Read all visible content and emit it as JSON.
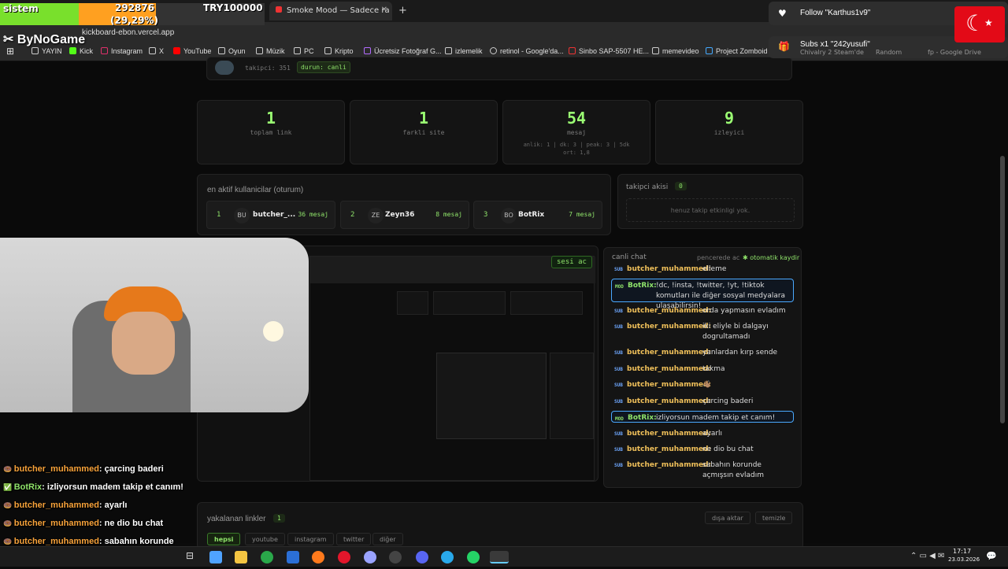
{
  "browser": {
    "tab_title": "Smoke Mood — Sadece ra",
    "address": "kickboard-ebon.vercel.app",
    "bookmarks": [
      "YAYIN",
      "Kick",
      "Instagram",
      "X",
      "YouTube",
      "Oyun",
      "Müzik",
      "PC",
      "Kripto",
      "Ücretsiz Fotoğraf G...",
      "izlemelik",
      "retinol - Google'da...",
      "Sinbo SAP-5507 HE...",
      "memevideo",
      "Project Zomboid S..."
    ],
    "popup_follow": "Follow \"Karthus1v9\"",
    "popup_subs": "Subs x1 \"242yusufi\"",
    "popup_sub_links": [
      "Chivalry 2 Steam'de",
      "Random",
      "fp - Google Drive"
    ]
  },
  "stream_overlay": {
    "label_left": "sistem",
    "counter_value": "292876",
    "counter_pct": "(29,29%)",
    "counter_target": "TRY100000",
    "brand": "ByNoGame",
    "progress_fraction": 0.2929
  },
  "header_card": {
    "followers_label": "takipci: 351",
    "status_label": "durun: canli"
  },
  "stats": [
    {
      "value": "1",
      "label": "toplam link",
      "sub": ""
    },
    {
      "value": "1",
      "label": "farkli site",
      "sub": ""
    },
    {
      "value": "54",
      "label": "mesaj",
      "sub": "anlik: 1 | dk: 3 | peak: 3 | 5dk ort: 1,8"
    },
    {
      "value": "9",
      "label": "izleyici",
      "sub": ""
    }
  ],
  "active_users": {
    "title": "en aktif kullanicilar (oturum)",
    "users": [
      {
        "rank": "1",
        "initials": "BU",
        "name": "butcher_...",
        "count": "36 mesaj"
      },
      {
        "rank": "2",
        "initials": "ZE",
        "name": "Zeyn36",
        "count": "8 mesaj"
      },
      {
        "rank": "3",
        "initials": "BO",
        "name": "BotRix",
        "count": "7 mesaj"
      }
    ]
  },
  "follow_flow": {
    "title": "takipci akisi",
    "count": "0",
    "empty": "henuz takip etkinligi yok."
  },
  "preview": {
    "audio_button": "sesi ac"
  },
  "live_chat": {
    "title": "canli chat",
    "popout": "pencerede ac",
    "autoscroll": "otomatik kaydir",
    "messages": [
      {
        "badge": "SUB",
        "user": "butcher_muhammed:",
        "text": "elleme",
        "bot": false
      },
      {
        "badge": "MOD",
        "user": "BotRix:",
        "text": "!dc, !insta, !twitter, !yt, !tiktok komutları ile diğer sosyal medyalara ulaşabilirsin!",
        "bot": true
      },
      {
        "badge": "SUB",
        "user": "butcher_muhammed:",
        "text": "orda yapmasın evladım",
        "bot": false
      },
      {
        "badge": "SUB",
        "user": "butcher_muhammed:",
        "text": "iki eliyle bi dalgayı dogrultamadı",
        "bot": false
      },
      {
        "badge": "SUB",
        "user": "butcher_muhammed:",
        "text": "yanlardan kırp sende",
        "bot": false
      },
      {
        "badge": "SUB",
        "user": "butcher_muhammed:",
        "text": "takma",
        "bot": false
      },
      {
        "badge": "SUB",
        "user": "butcher_muhammed:",
        "text": "👋🏽",
        "bot": false
      },
      {
        "badge": "SUB",
        "user": "butcher_muhammed:",
        "text": "çarcing baderi",
        "bot": false
      },
      {
        "badge": "MOD",
        "user": "BotRix:",
        "text": "izliyorsun madem takip et canım!",
        "bot": true
      },
      {
        "badge": "SUB",
        "user": "butcher_muhammed:",
        "text": "ayarlı",
        "bot": false
      },
      {
        "badge": "SUB",
        "user": "butcher_muhammed:",
        "text": "ne dio bu chat",
        "bot": false
      },
      {
        "badge": "SUB",
        "user": "butcher_muhammed:",
        "text": "sabahın korunde açmışsın evladım",
        "bot": false
      }
    ]
  },
  "links": {
    "title": "yakalanan linkler",
    "count": "1",
    "export": "dışa aktar",
    "clear": "temizle",
    "filters": [
      "hepsi",
      "youtube",
      "instagram",
      "twitter",
      "diğer"
    ]
  },
  "overlay_chat": [
    {
      "user": "butcher_muhammed",
      "text": ": çarcing baderi",
      "bot": false
    },
    {
      "user": "BotRix",
      "text": ": izliyorsun madem takip et canım!",
      "bot": true
    },
    {
      "user": "butcher_muhammed",
      "text": ": ayarlı",
      "bot": false
    },
    {
      "user": "butcher_muhammed",
      "text": ": ne dio bu chat",
      "bot": false
    },
    {
      "user": "butcher_muhammed",
      "text": ": sabahın korunde",
      "bot": false
    },
    {
      "user": "",
      "text": "açmışsın evladım",
      "bot": false
    }
  ],
  "taskbar": {
    "time": "17:17",
    "date": "23.03.2026"
  }
}
